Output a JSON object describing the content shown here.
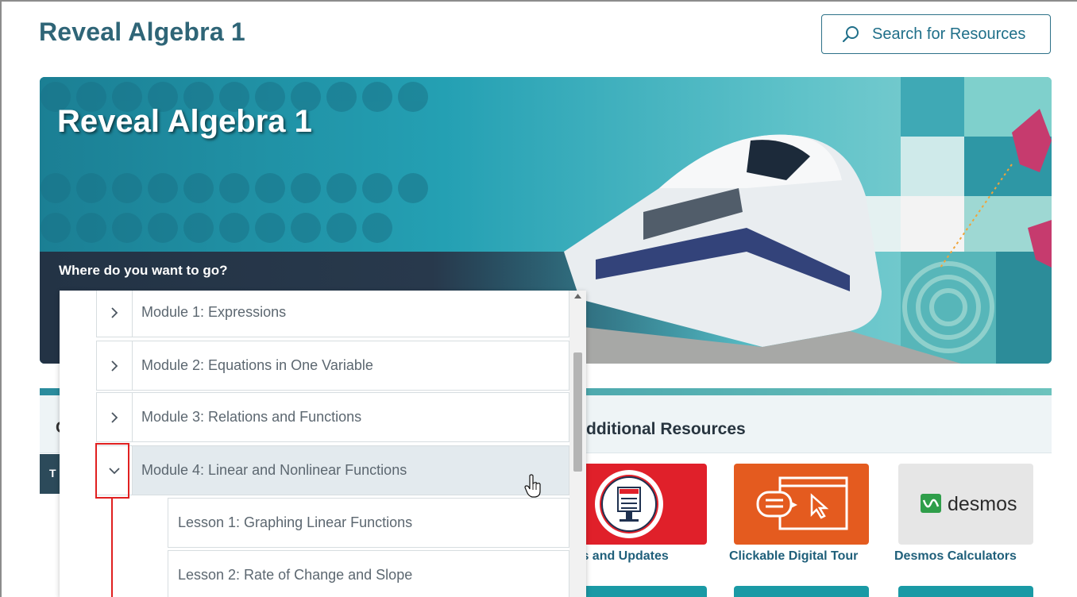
{
  "page": {
    "title": "Reveal Algebra 1"
  },
  "search": {
    "label": "Search for Resources",
    "icon": "search-icon"
  },
  "banner": {
    "title": "Reveal Algebra 1",
    "prompt": "Where do you want to go?"
  },
  "card": {
    "left_letter": "C",
    "heading_fragment": "dditional Resources",
    "tab_letter": "T",
    "resources": [
      {
        "label": "ws and Updates",
        "icon": "news-icon",
        "color": "#e0202a"
      },
      {
        "label": "Clickable Digital Tour",
        "icon": "tour-icon",
        "color": "#e45b1f"
      },
      {
        "label": "Desmos Calculators",
        "icon": "desmos-logo",
        "color": "#e6e6e6"
      }
    ]
  },
  "dropdown": {
    "modules": [
      {
        "label": "Module 1: Expressions",
        "icon": "chevron-right-icon",
        "expanded": false
      },
      {
        "label": "Module 2: Equations in One Variable",
        "icon": "chevron-right-icon",
        "expanded": false
      },
      {
        "label": "Module 3: Relations and Functions",
        "icon": "chevron-right-icon",
        "expanded": false
      },
      {
        "label": "Module 4: Linear and Nonlinear Functions",
        "icon": "chevron-down-icon",
        "expanded": true
      }
    ],
    "lessons": [
      {
        "label": "Lesson 1: Graphing Linear Functions"
      },
      {
        "label": "Lesson 2: Rate of Change and Slope"
      }
    ]
  },
  "desmos": {
    "wordmark": "desmos"
  },
  "colors": {
    "title": "#2f6577",
    "accent": "#1f6f89",
    "annotation": "#e02020"
  }
}
